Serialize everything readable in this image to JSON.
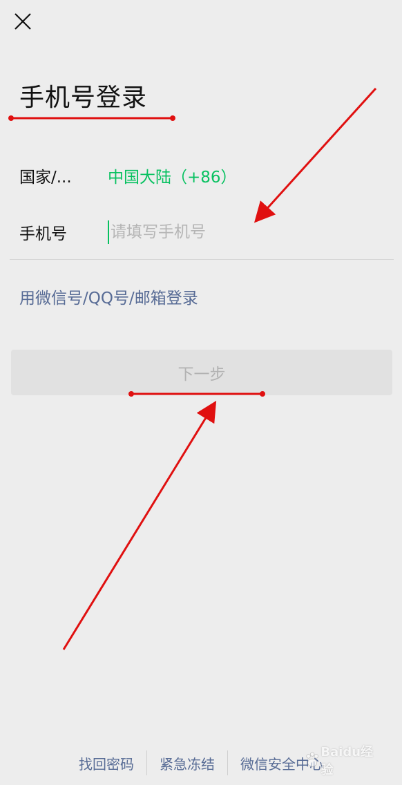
{
  "page": {
    "title": "手机号登录"
  },
  "country": {
    "label": "国家/...",
    "value": "中国大陆（+86）"
  },
  "phone": {
    "label": "手机号",
    "placeholder": "请填写手机号",
    "value": ""
  },
  "alt_login": {
    "label": "用微信号/QQ号/邮箱登录"
  },
  "next_button": {
    "label": "下一步"
  },
  "footer": {
    "links": [
      "找回密码",
      "紧急冻结",
      "微信安全中心"
    ]
  },
  "colors": {
    "accent": "#07c160",
    "link": "#576b95",
    "annotation": "#e01010"
  },
  "icons": {
    "close": "close-icon"
  },
  "watermark": {
    "text": "Baidu经验"
  }
}
